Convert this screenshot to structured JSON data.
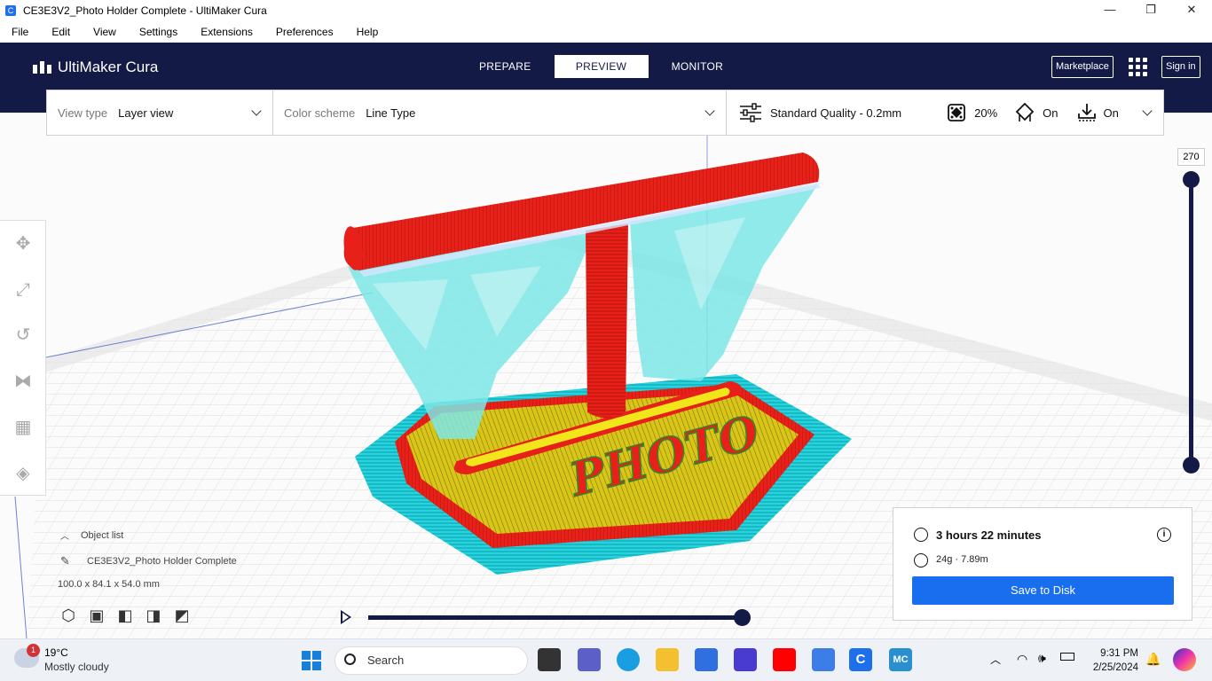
{
  "window": {
    "title": "CE3E3V2_Photo Holder Complete - UltiMaker Cura",
    "controls": [
      "—",
      "❐",
      "✕"
    ]
  },
  "menu": [
    "File",
    "Edit",
    "View",
    "Settings",
    "Extensions",
    "Preferences",
    "Help"
  ],
  "header": {
    "logo": "UltiMaker Cura",
    "tabs": [
      {
        "label": "PREPARE",
        "active": false
      },
      {
        "label": "PREVIEW",
        "active": true
      },
      {
        "label": "MONITOR",
        "active": false
      }
    ],
    "marketplace": "Marketplace",
    "signin": "Sign in"
  },
  "toolbar": {
    "view_type_label": "View type",
    "view_type_value": "Layer view",
    "color_scheme_label": "Color scheme",
    "color_scheme_value": "Line Type",
    "quality": "Standard Quality - 0.2mm",
    "infill": "20%",
    "support": "On",
    "adhesion": "On"
  },
  "layer_slider": {
    "value": "270"
  },
  "object_list": {
    "header": "Object list",
    "item": "CE3E3V2_Photo Holder Complete",
    "dimensions": "100.0 x 84.1 x 54.0 mm"
  },
  "print_info": {
    "time": "3 hours 22 minutes",
    "material": "24g · 7.89m",
    "save_button": "Save to Disk"
  },
  "model": {
    "text": "PHOTO"
  },
  "colors": {
    "header_bg": "#141a46",
    "accent_blue": "#196ef0",
    "wall_red": "#e8201a",
    "support_cyan": "#7ce6e6",
    "skin_yellow": "#e2d21a",
    "skirt_cyan": "#22d5e0"
  },
  "taskbar": {
    "weather_temp": "19°C",
    "weather_desc": "Mostly cloudy",
    "weather_badge": "1",
    "search": "Search",
    "time": "9:31 PM",
    "date": "2/25/2024"
  }
}
